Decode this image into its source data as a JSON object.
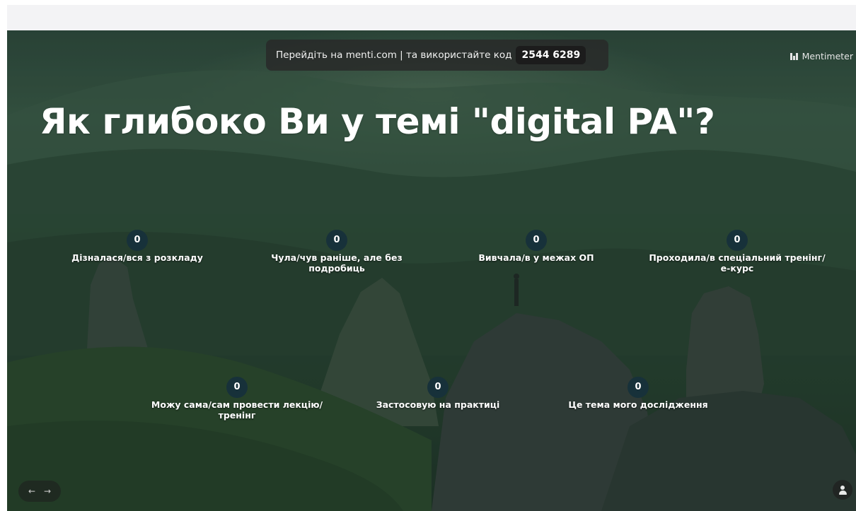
{
  "join_bar": {
    "instruction": "Перейдіть на menti.com | та використайте код",
    "code": "2544 6289"
  },
  "brand": {
    "name": "Mentimeter"
  },
  "question": {
    "title": "Як глибоко Ви у темі \"digital PA\"?"
  },
  "options": [
    {
      "count": "0",
      "label": "Дізналася/вся з розкладу"
    },
    {
      "count": "0",
      "label": "Чула/чув раніше, але без подробиць"
    },
    {
      "count": "0",
      "label": "Вивчала/в у межах ОП"
    },
    {
      "count": "0",
      "label": "Проходила/в спеціальний тренінг/ е-курс"
    },
    {
      "count": "0",
      "label": "Можу сама/сам провести лекцію/ тренінг"
    },
    {
      "count": "0",
      "label": "Застосовую на практиці"
    },
    {
      "count": "0",
      "label": "Це тема мого дослідження"
    }
  ],
  "nav": {
    "prev_icon": "←",
    "next_icon": "→"
  },
  "icons": {
    "logo": "mentimeter-logo-icon",
    "person": "person-icon"
  }
}
